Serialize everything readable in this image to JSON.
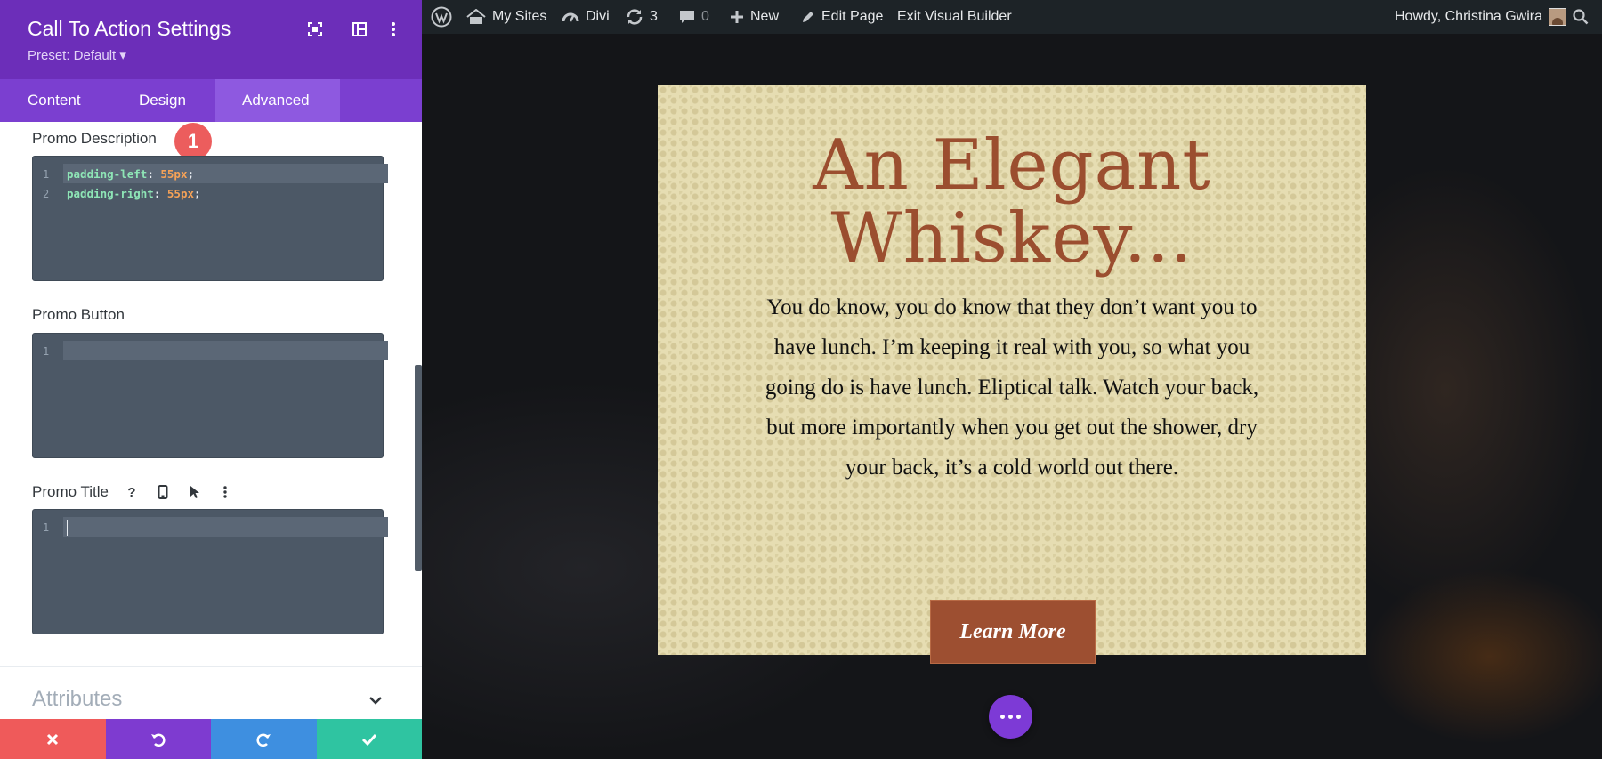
{
  "panel": {
    "title": "Call To Action Settings",
    "preset": "Preset: Default ▾",
    "tabs": [
      {
        "label": "Content"
      },
      {
        "label": "Design"
      },
      {
        "label": "Advanced"
      }
    ],
    "fields": {
      "promo_description": {
        "label": "Promo Description",
        "badge": "1",
        "line_numbers": [
          "1",
          "2"
        ],
        "code": [
          {
            "prop": "padding-left",
            "value": "55px"
          },
          {
            "prop": "padding-right",
            "value": "55px"
          }
        ]
      },
      "promo_button": {
        "label": "Promo Button",
        "line_numbers": [
          "1"
        ]
      },
      "promo_title": {
        "label": "Promo Title",
        "help_glyph": "?",
        "line_numbers": [
          "1"
        ]
      }
    },
    "attributes_label": "Attributes"
  },
  "adminbar": {
    "my_sites": "My Sites",
    "divi": "Divi",
    "updates_count": "3",
    "comments_count": "0",
    "new": "New",
    "edit_page": "Edit Page",
    "exit_builder": "Exit Visual Builder",
    "howdy": "Howdy, Christina Gwira"
  },
  "cta": {
    "title_line1": "An Elegant",
    "title_line2": "Whiskey...",
    "description": "You do know, you do know that they don’t want you to have lunch. I’m keeping it real with you, so what you going do is have lunch. Eliptical talk. Watch your back, but more importantly when you get out the shower, dry your back, it’s a cold world out there.",
    "button": "Learn More"
  },
  "colors": {
    "header_purple": "#6c2eb9",
    "tabs_purple": "#7b3fd0",
    "cancel_red": "#ef5a5a",
    "undo_purple": "#7e3bd0",
    "redo_blue": "#3e8fe0",
    "save_green": "#2fc4a1",
    "cta_background": "#e6ddb2",
    "cta_title": "#9b4e2f",
    "cta_button": "#9d4f31"
  },
  "icons": {
    "header": [
      "expand-icon",
      "layout-icon",
      "more-vertical-icon"
    ],
    "footer": [
      "close-icon",
      "undo-icon",
      "redo-icon",
      "check-icon"
    ],
    "promo_title_options": [
      "help-icon",
      "mobile-icon",
      "cursor-icon",
      "more-vertical-icon"
    ]
  }
}
